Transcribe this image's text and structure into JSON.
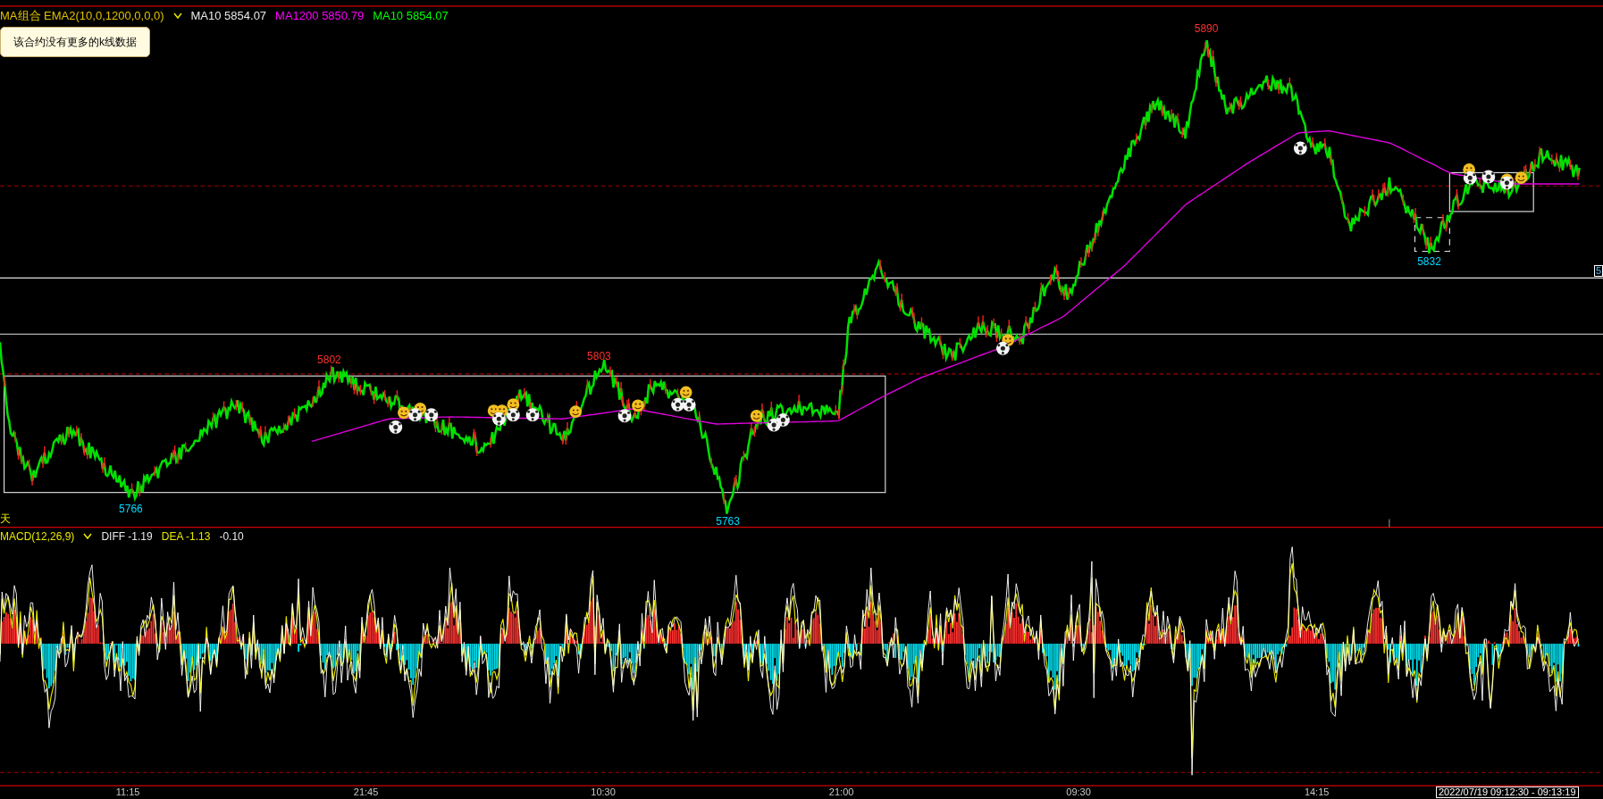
{
  "legend": {
    "study": "MA组合 EMA2(10,0,1200,0,0,0)",
    "items": [
      {
        "text": "MA10 5854.07",
        "color": "#e8e8e8"
      },
      {
        "text": "MA1200 5850.79",
        "color": "#ff00ff"
      },
      {
        "text": "MA10 5854.07",
        "color": "#00ff00"
      }
    ]
  },
  "tooltip": "该合约没有更多的k线数据",
  "price_labels": [
    {
      "text": "5890",
      "kind": "high"
    },
    {
      "text": "5832",
      "kind": "low"
    },
    {
      "text": "5802",
      "kind": "high"
    },
    {
      "text": "5803",
      "kind": "high"
    },
    {
      "text": "5766",
      "kind": "low"
    },
    {
      "text": "5763",
      "kind": "low"
    }
  ],
  "right_price_tag": "5",
  "period_mark": "天",
  "macd_legend": {
    "study": "MACD(12,26,9)",
    "items": [
      {
        "text": "DIFF -1.19",
        "color": "#e8e8e8"
      },
      {
        "text": "DEA -1.13",
        "color": "#e8e800"
      },
      {
        "text": "-0.10",
        "color": "#e8e8e8"
      }
    ]
  },
  "time_axis": [
    "11:15",
    "21:45",
    "10:30",
    "21:00",
    "09:30",
    "14:15"
  ],
  "cursor_time": "2022/07/19 09:12:30 - 09:13:19"
}
